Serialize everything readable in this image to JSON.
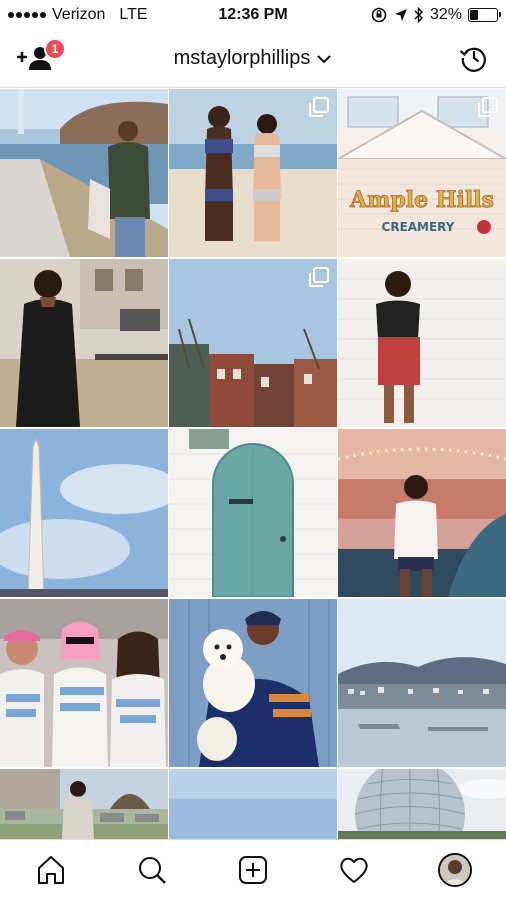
{
  "status_bar": {
    "carrier": "Verizon",
    "network": "LTE",
    "time": "12:36 PM",
    "battery_percent": "32%",
    "battery_level": 0.32
  },
  "header": {
    "username": "mstaylorphillips",
    "notification_count": "1",
    "left_icon": "add-person-icon",
    "right_icon": "history-icon"
  },
  "grid": {
    "rows": 5,
    "columns": 3,
    "sign_text_line1": "Ample Hills",
    "sign_text_line2": "CREAMERY"
  },
  "bottom_nav": {
    "items": [
      "home-icon",
      "search-icon",
      "new-post-icon",
      "activity-heart-icon",
      "profile-avatar"
    ]
  },
  "colors": {
    "accent_red": "#ed4956",
    "divider": "#dbdbdb"
  }
}
